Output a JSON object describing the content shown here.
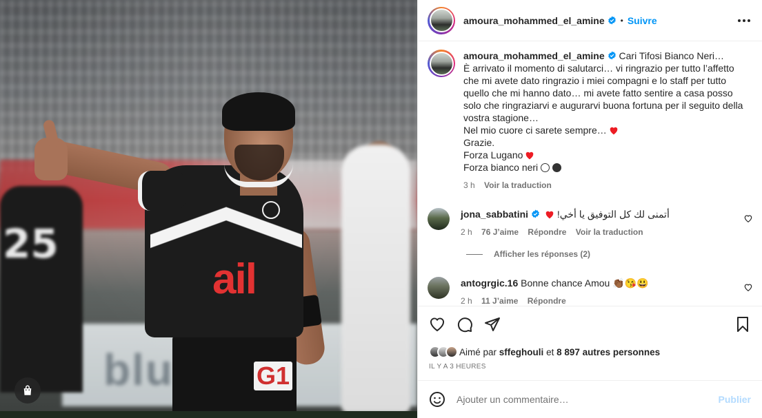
{
  "post": {
    "username": "amoura_mohammed_el_amine",
    "follow_label": "Suivre",
    "separator": "•",
    "photo_text": {
      "jersey_sponsor": "ail",
      "shorts_number": "G1",
      "left_player_number": "25",
      "ad_board_text": "blu"
    }
  },
  "caption": {
    "username": "amoura_mohammed_el_amine",
    "lines": [
      "Cari Tifosi Bianco Neri…",
      "È arrivato il momento di salutarci… vi ringrazio per tutto l’affetto che mi avete dato ringrazio i miei compagni e lo staff per tutto quello che mi hanno dato… mi avete fatto sentire a casa posso solo che ringraziarvi e augurarvi buona fortuna per il seguito della vostra stagione…",
      "Nel mio cuore ci sarete sempre…",
      "Grazie.",
      "Forza Lugano",
      "Forza bianco neri"
    ],
    "time": "3 h",
    "translate_label": "Voir la traduction"
  },
  "comments": [
    {
      "username": "jona_sabbatini",
      "text": "أتمنى لك كل التوفيق يا أخي!",
      "time": "2 h",
      "likes": "76 J’aime",
      "reply_label": "Répondre",
      "translate_label": "Voir la traduction"
    },
    {
      "username": "antogrgic.16",
      "text": "Bonne chance Amou",
      "time": "2 h",
      "likes": "11 J’aime",
      "reply_label": "Répondre"
    }
  ],
  "replies_label": "Afficher les réponses (2)",
  "likes": {
    "prefix": "Aimé par",
    "user": "sffeghouli",
    "connector": "et",
    "count": "8 897 autres personnes"
  },
  "timestamp": "IL Y A 3 HEURES",
  "add_comment": {
    "placeholder": "Ajouter un commentaire…",
    "publish_label": "Publier"
  },
  "colors": {
    "link_blue": "#0095f6",
    "publish_disabled": "#b3dbff",
    "heart_red": "#ed1c24",
    "secondary_text": "#737373"
  },
  "icons": [
    "more-icon",
    "verified-icon",
    "heart-icon",
    "comment-icon",
    "share-icon",
    "bookmark-icon",
    "emoji-icon",
    "shopping-bag-icon"
  ]
}
